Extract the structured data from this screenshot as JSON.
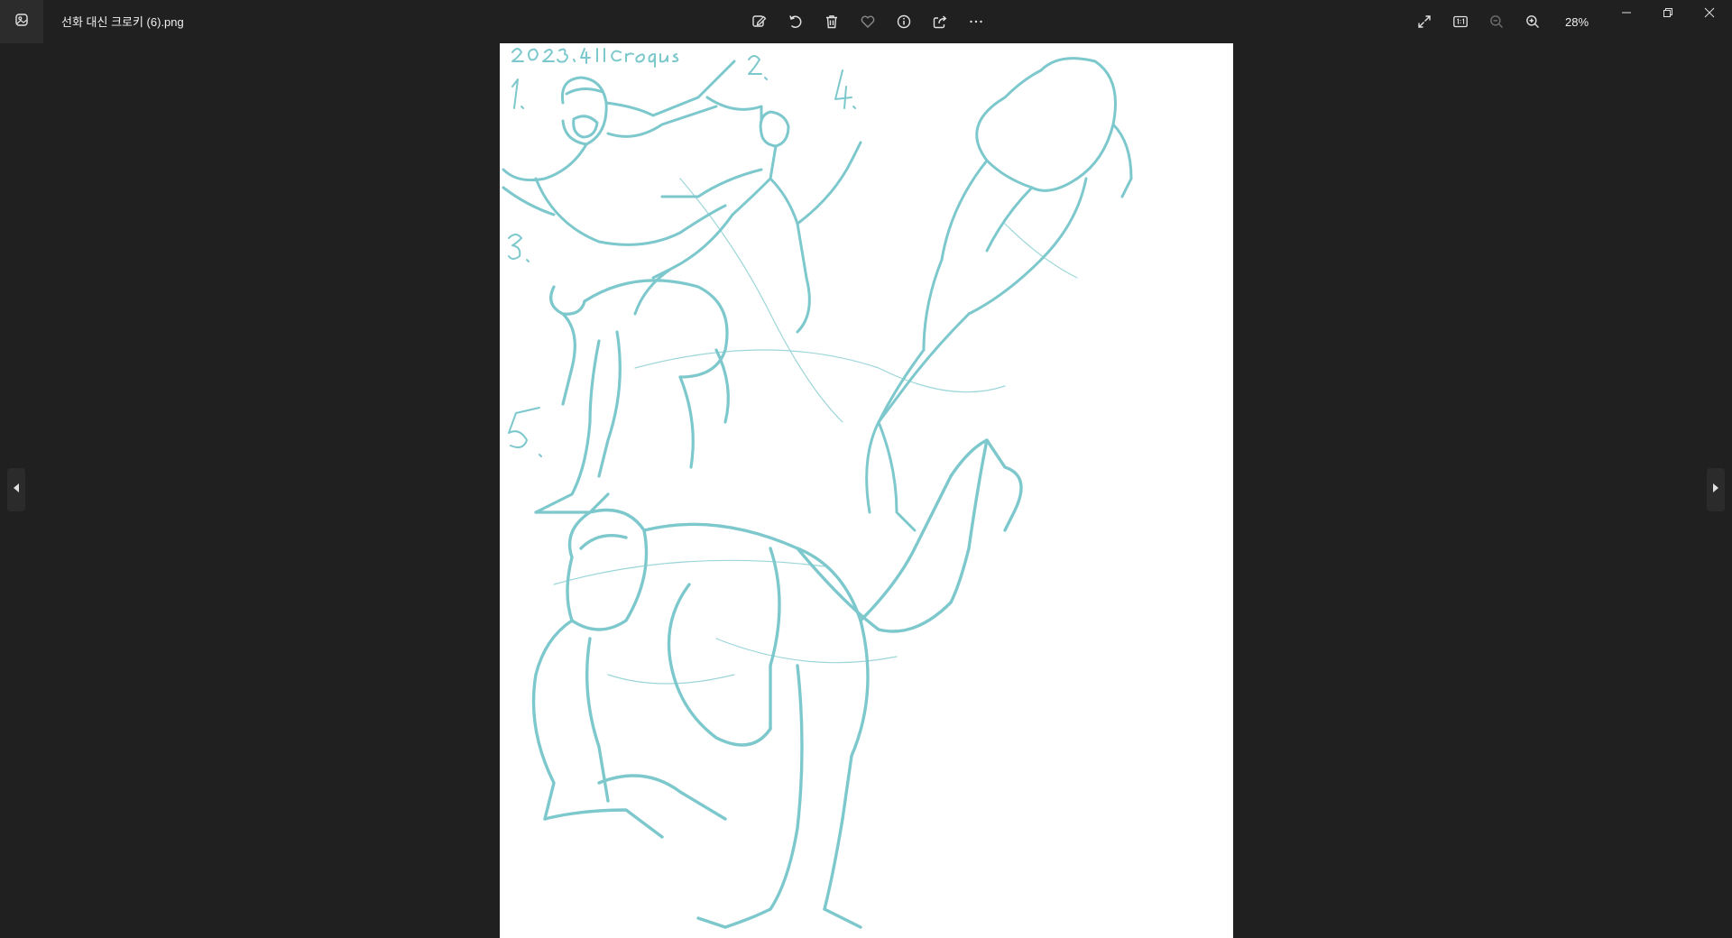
{
  "window": {
    "file_name": "선화 대신 크로키 (6).png"
  },
  "toolbar": {
    "icons": [
      "edit-image-icon",
      "rotate-icon",
      "delete-icon",
      "favorite-icon",
      "info-icon",
      "share-icon",
      "more-options-icon"
    ]
  },
  "zoom": {
    "icons": [
      "fullscreen-icon",
      "actual-size-icon",
      "zoom-out-icon",
      "zoom-in-icon"
    ],
    "level": "28%"
  },
  "window_controls": {
    "icons": [
      "minimize-icon",
      "restore-icon",
      "close-icon"
    ]
  },
  "navigation": {
    "icons": [
      "previous-arrow-icon",
      "next-arrow-icon"
    ]
  },
  "image": {
    "handwritten_stamp": "2023.04.11 Croquis",
    "stroke_color": "#7cc8cc",
    "background_color": "#ffffff"
  },
  "colors": {
    "app_background": "#202020",
    "icon": "#e0e0e0"
  }
}
